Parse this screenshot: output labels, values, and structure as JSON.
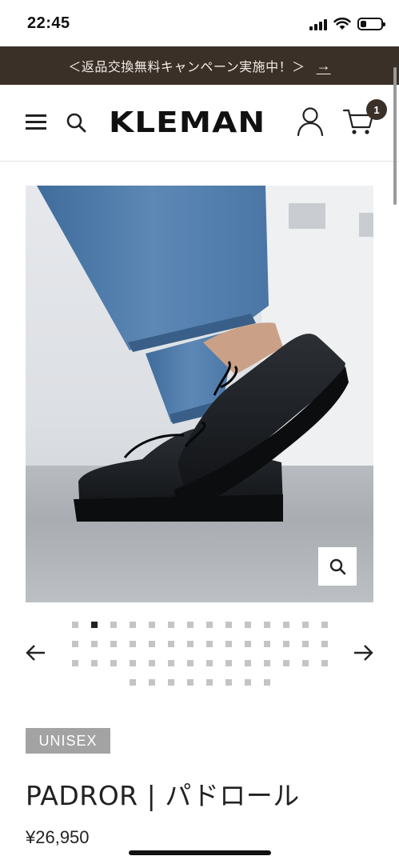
{
  "status_bar": {
    "time": "22:45",
    "icons": [
      "signal-icon",
      "wifi-icon",
      "battery-icon"
    ],
    "battery_level": 0.25
  },
  "announcement": {
    "text": "＜返品交換無料キャンペーン実施中！＞",
    "arrow": "→",
    "background": "#3b3028"
  },
  "header": {
    "logo": "KLEMAN",
    "icons": [
      "menu-icon",
      "search-icon",
      "account-icon",
      "cart-icon"
    ],
    "cart_count": "1"
  },
  "gallery": {
    "image": "model-wearing-black-leather-shoes",
    "zoom_icon": "zoom-icon",
    "prev_icon": "arrow-left-icon",
    "next_icon": "arrow-right-icon",
    "total_slides": 50,
    "active_slide": 2
  },
  "product": {
    "tag": "UNISEX",
    "title": "PADROR | パドロール",
    "price": "¥26,950"
  },
  "colors": {
    "brand": "#3b3028",
    "tag_bg": "#a3a3a3",
    "inactive_dot": "#c4c4c4"
  }
}
